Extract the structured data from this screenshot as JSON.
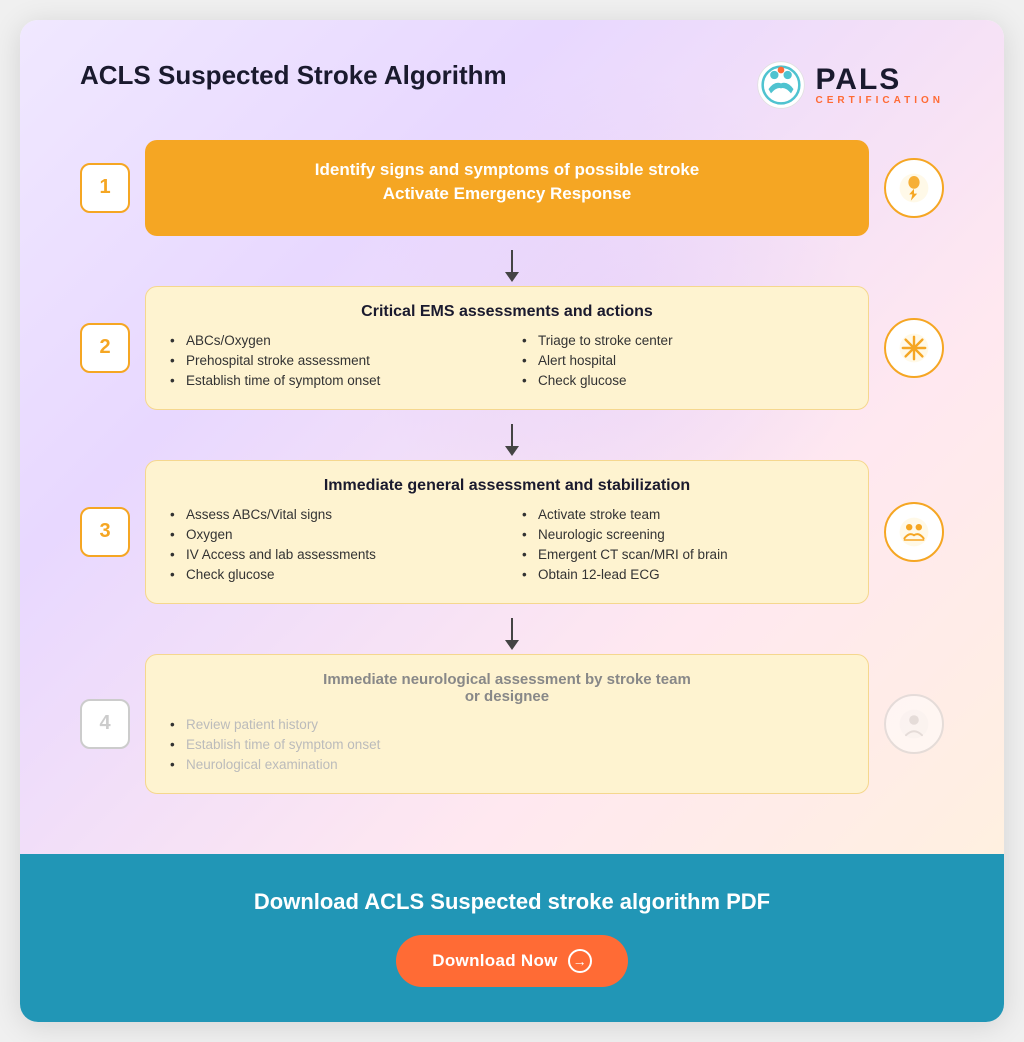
{
  "page": {
    "title": "ACLS Suspected Stroke Algorithm"
  },
  "logo": {
    "pals": "PALS",
    "certification": "CERTIFICATION"
  },
  "steps": [
    {
      "number": "1",
      "title": "Identify signs and symptoms of possible stroke\nActivate Emergency Response",
      "type": "header",
      "icon": "emergency-icon"
    },
    {
      "number": "2",
      "title": "Critical EMS assessments and actions",
      "type": "two-col",
      "col1": [
        "ABCs/Oxygen",
        "Prehospital stroke assessment",
        "Establish time of symptom onset"
      ],
      "col2": [
        "Triage to stroke center",
        "Alert hospital",
        "Check glucose"
      ],
      "icon": "asterisk-icon"
    },
    {
      "number": "3",
      "title": "Immediate general assessment and stabilization",
      "type": "two-col",
      "col1": [
        "Assess ABCs/Vital signs",
        "Oxygen",
        "IV Access and lab assessments",
        "Check glucose"
      ],
      "col2": [
        "Activate stroke team",
        "Neurologic screening",
        "Emergent CT scan/MRI of brain",
        "Obtain 12-lead ECG"
      ],
      "icon": "team-icon"
    },
    {
      "number": "4",
      "title": "Immediate neurological assessment by stroke team\nor designee",
      "type": "single-col",
      "col1": [
        "Review patient history",
        "Establish time of symptom onset",
        "Neurological examination"
      ],
      "icon": "neuro-icon",
      "faded": true
    }
  ],
  "footer": {
    "title": "Download ACLS Suspected stroke algorithm PDF",
    "button_label": "Download Now",
    "button_icon": "arrow-right-icon"
  }
}
